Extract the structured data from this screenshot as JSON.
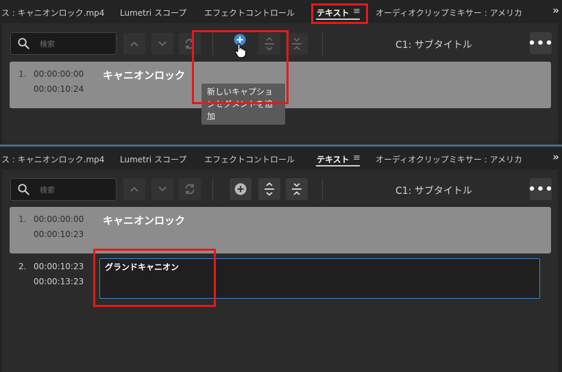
{
  "tabs": {
    "source": "ス : キャニオンロック.mp4",
    "lumetri": "Lumetri スコープ",
    "effects": "エフェクトコントロール",
    "text": "テキスト",
    "audio_mixer": "オーディオクリップミキサー : アメリカ"
  },
  "icons": {
    "tab_menu": "≡",
    "overflow": "»",
    "more": "•••"
  },
  "toolbar": {
    "search_placeholder": "検索",
    "track_label": "C1: サブタイトル"
  },
  "tooltip": {
    "add_caption_segment": "新しいキャプションセグメントを追加"
  },
  "top_panel": {
    "captions": [
      {
        "index": "1.",
        "start": "00:00:00:00",
        "end": "00:00:10:24",
        "text": "キャニオンロック"
      }
    ]
  },
  "bottom_panel": {
    "captions": [
      {
        "index": "1.",
        "start": "00:00:00:00",
        "end": "00:00:10:23",
        "text": "キャニオンロック"
      },
      {
        "index": "2.",
        "start": "00:00:10:23",
        "end": "00:00:13:23",
        "text": "グランドキャニオン"
      }
    ]
  },
  "colors": {
    "highlight": "#e31a1c",
    "accent_blue": "#3f87d6",
    "selected_row": "#8c8c8c"
  }
}
